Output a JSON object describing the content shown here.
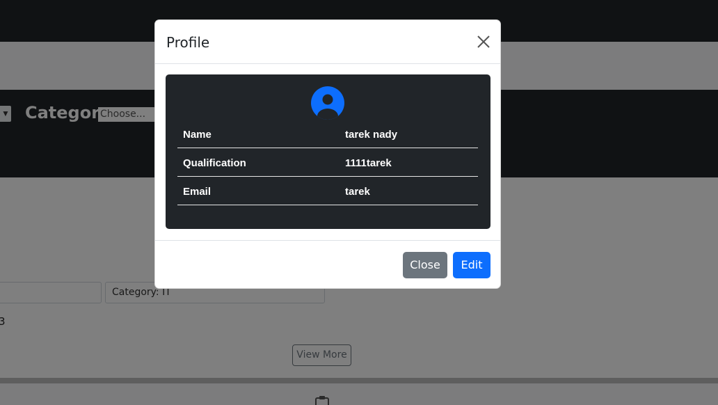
{
  "page": {
    "category_label": "Category",
    "category_select_placeholder": "Choose...",
    "category_field_text": "Category: IT",
    "content_digit": "3",
    "view_more_label": "View More"
  },
  "modal": {
    "title": "Profile",
    "rows": [
      {
        "key": "Name",
        "value": "tarek nady"
      },
      {
        "key": "Qualification",
        "value": "1111tarek"
      },
      {
        "key": "Email",
        "value": "tarek"
      }
    ],
    "close_label": "Close",
    "edit_label": "Edit"
  },
  "icons": {
    "close": "close-icon",
    "avatar": "person-circle-icon",
    "clipboard": "clipboard-icon",
    "chevron": "chevron-down-icon"
  },
  "colors": {
    "dark": "#212529",
    "primary": "#0d6efd",
    "secondary": "#6c757d"
  }
}
